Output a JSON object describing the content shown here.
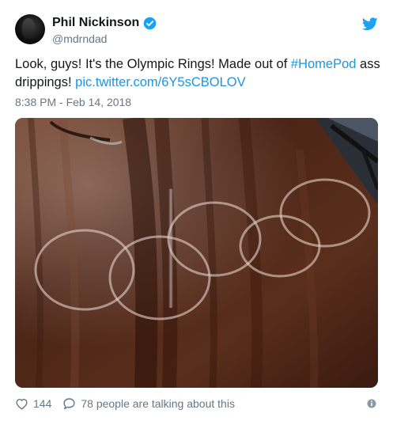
{
  "tweet": {
    "author_name": "Phil Nickinson",
    "author_handle": "@mdrndad",
    "text_prefix": "Look, guys! It's the Olympic Rings! Made out of ",
    "hashtag": "#HomePod",
    "text_suffix": " ass drippings! ",
    "pic_link": "pic.twitter.com/6Y5sCBOLOV",
    "timestamp": "8:38 PM - Feb 14, 2018",
    "like_count": "144",
    "talking_text": "78 people are talking about this"
  },
  "icons": {
    "verified": "verified-badge-icon",
    "brand": "twitter-bird-icon",
    "like": "heart-icon",
    "reply": "comment-bubble-icon",
    "info": "info-icon"
  },
  "colors": {
    "link": "#1b95e0",
    "verified": "#1da1f2",
    "muted": "#657786",
    "text": "#14171a",
    "wood": "#4a2416"
  }
}
